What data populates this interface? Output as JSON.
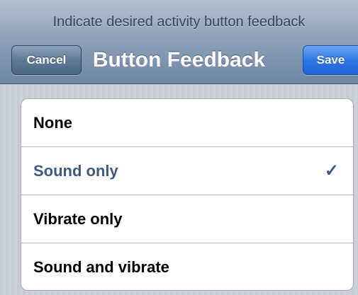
{
  "header": {
    "prompt": "Indicate desired activity button feedback",
    "title": "Button Feedback",
    "cancel_label": "Cancel",
    "save_label": "Save"
  },
  "options": [
    {
      "label": "None",
      "selected": false
    },
    {
      "label": "Sound only",
      "selected": true
    },
    {
      "label": "Vibrate only",
      "selected": false
    },
    {
      "label": "Sound and vibrate",
      "selected": false
    }
  ],
  "icons": {
    "checkmark": "check-icon"
  },
  "colors": {
    "selected_text": "#3d5a80",
    "checkmark": "#3b5a8c",
    "save_button": "#2f77e6",
    "cancel_button": "#5f7896"
  }
}
